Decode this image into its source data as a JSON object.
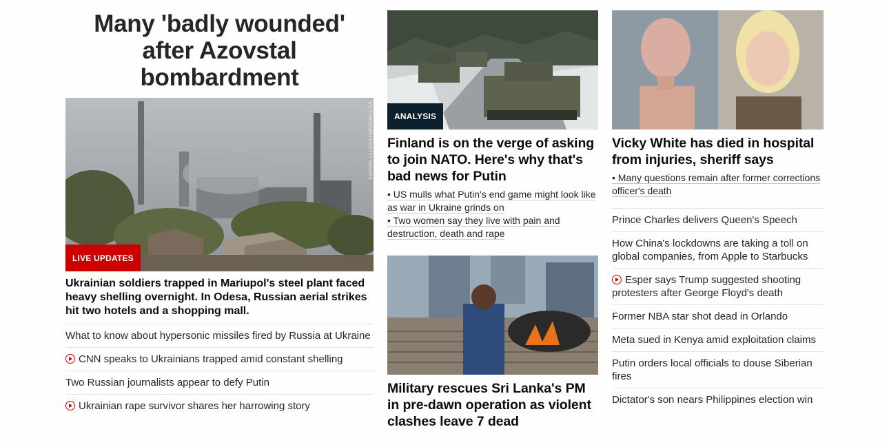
{
  "col1": {
    "title": "Many 'badly wounded' after Azovstal bombardment",
    "badge": "LIVE UPDATES",
    "credit": "VICTOR/XINHUA/GETTY IMAGES",
    "lead": "Ukrainian soldiers trapped in Mariupol's steel plant faced heavy shelling overnight. In Odesa, Russian aerial strikes hit two hotels and a shopping mall.",
    "links": [
      {
        "label": "What to know about hypersonic missiles fired by Russia at Ukraine",
        "video": false
      },
      {
        "label": "CNN speaks to Ukrainians trapped amid constant shelling",
        "video": true
      },
      {
        "label": "Two Russian journalists appear to defy Putin",
        "video": false
      },
      {
        "label": "Ukrainian rape survivor shares her harrowing story",
        "video": true
      }
    ]
  },
  "col2": {
    "story1": {
      "badge": "ANALYSIS",
      "headline": "Finland is on the verge of asking to join NATO. Here's why that's bad news for Putin",
      "bullets": [
        "• US mulls what Putin's end game might look like as war in Ukraine grinds on",
        "• Two women say they live with pain and destruction, death and rape"
      ]
    },
    "story2": {
      "headline": "Military rescues Sri Lanka's PM in pre-dawn operation as violent clashes leave 7 dead"
    }
  },
  "col3": {
    "headline": "Vicky White has died in hospital from injuries, sheriff says",
    "bullets": [
      "• Many questions remain after former corrections officer's death"
    ],
    "links": [
      {
        "label": "Prince Charles delivers Queen's Speech",
        "video": false
      },
      {
        "label": "How China's lockdowns are taking a toll on global companies, from Apple to Starbucks",
        "video": false
      },
      {
        "label": "Esper says Trump suggested shooting protesters after George Floyd's death",
        "video": true
      },
      {
        "label": "Former NBA star shot dead in Orlando",
        "video": false
      },
      {
        "label": "Meta sued in Kenya amid exploitation claims",
        "video": false
      },
      {
        "label": "Putin orders local officials to douse Siberian fires",
        "video": false
      },
      {
        "label": "Dictator's son nears Philippines election win",
        "video": false
      }
    ]
  },
  "icons": {
    "video": "play-circle-icon"
  },
  "colors": {
    "live": "#cc0000",
    "analysis": "#0c1f2d",
    "text": "#0c0c0c"
  }
}
